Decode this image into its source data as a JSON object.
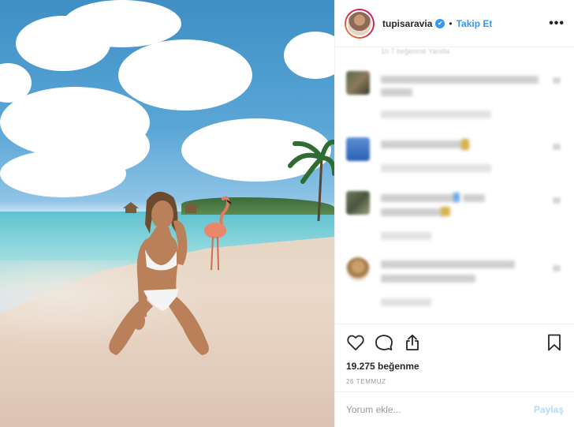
{
  "header": {
    "username": "tupisaravia",
    "verified_icon": "✔",
    "separator": "•",
    "follow_label": "Takip Et",
    "more_label": "•••"
  },
  "comments": {
    "top_partial_text": "1h    7 beğenme    Yanıtla"
  },
  "actions": {
    "likes": "19.275 beğenme",
    "date": "26 TEMMUZ"
  },
  "comment_box": {
    "placeholder": "Yorum ekle...",
    "post_label": "Paylaş"
  },
  "colors": {
    "link": "#3897f0",
    "post_disabled": "#b3dbff",
    "muted": "#999999"
  },
  "icons": [
    "heart-icon",
    "comment-icon",
    "share-icon",
    "bookmark-icon",
    "verified-icon",
    "more-icon"
  ]
}
